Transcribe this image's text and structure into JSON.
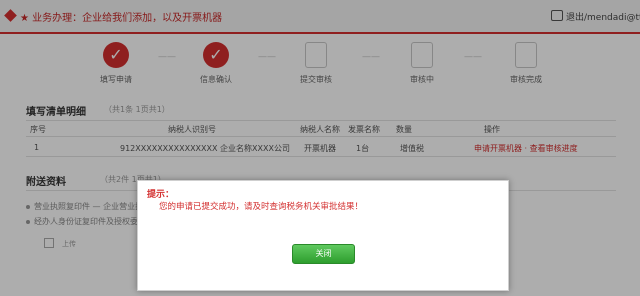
{
  "topbar": {
    "title": "★ 业务办理：企业给我们添加，以及开票机器",
    "right_text": "退出/mendadi@ttt"
  },
  "steps": [
    {
      "label": "填写申请",
      "done": true
    },
    {
      "label": "信息确认",
      "done": true
    },
    {
      "label": "提交审核",
      "done": false
    },
    {
      "label": "审核中",
      "done": false
    },
    {
      "label": "审核完成",
      "done": false
    }
  ],
  "section1": {
    "title": "填写清单明细",
    "sub": "（共1条 1页共1）",
    "headers": [
      "序号",
      "纳税人识别号",
      "纳税人名称",
      "发票名称",
      "数量",
      "操作"
    ],
    "row": [
      "1",
      "912XXXXXXXXXXXXXXX 企业名称XXXX公司",
      "开票机器",
      "1台",
      "增值税",
      "申请开票机器 · 查看审核进度"
    ]
  },
  "section2": {
    "title": "附送资料",
    "sub": "（共2件 1页共1）",
    "items": [
      "营业执照复印件 — 企业营业执照副本加盖公章",
      "经办人身份证复印件及授权委托书"
    ],
    "upload_text": "上传"
  },
  "dialog": {
    "title": "提示：",
    "message": "您的申请已提交成功，请及时查询税务机关审批结果！",
    "button_label": "关闭"
  }
}
